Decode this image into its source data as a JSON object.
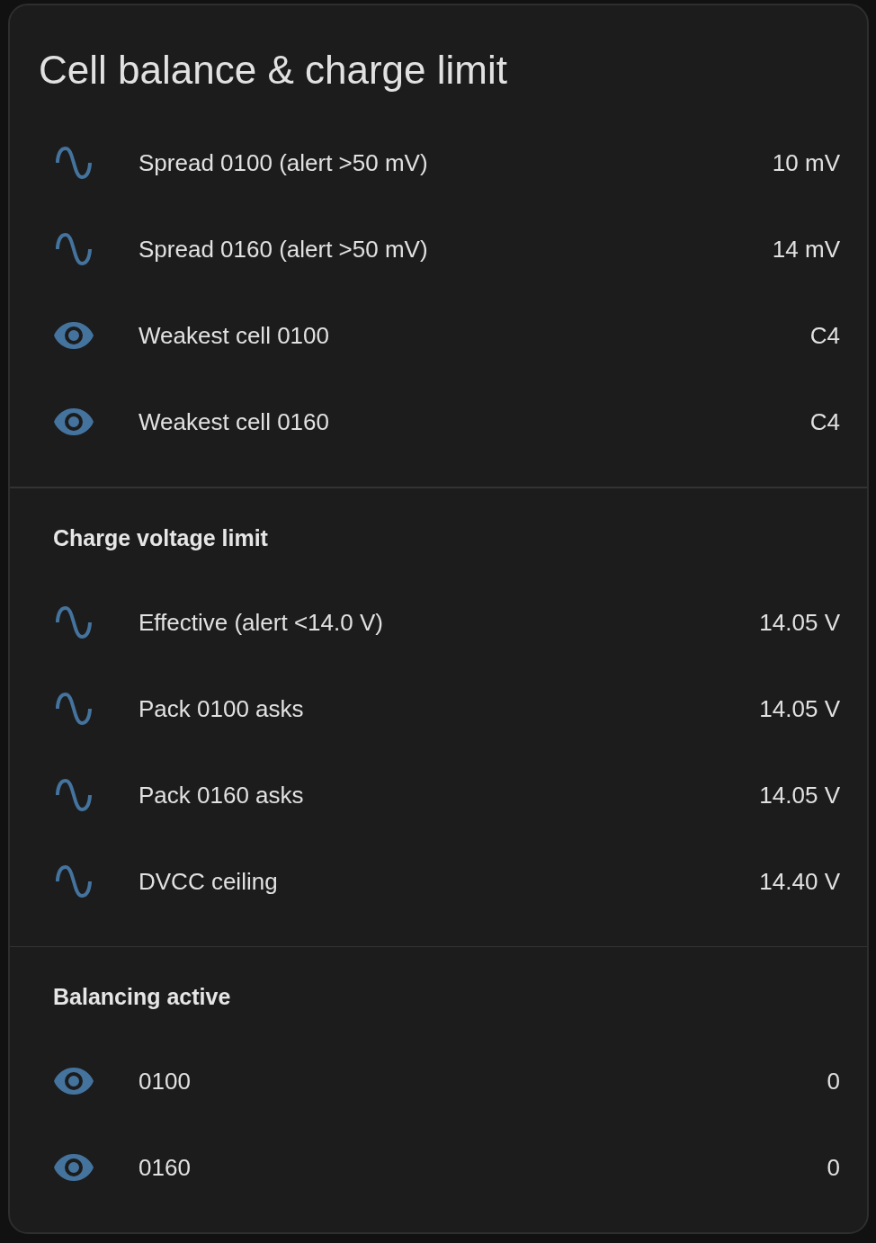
{
  "card": {
    "title": "Cell balance & charge limit",
    "sections": [
      {
        "rows": [
          {
            "kind": "measure",
            "name": "Spread 0100 (alert >50 mV)",
            "value": "10 mV"
          },
          {
            "kind": "measure",
            "name": "Spread 0160 (alert >50 mV)",
            "value": "14 mV"
          },
          {
            "kind": "watch",
            "name": "Weakest cell 0100",
            "value": "C4"
          },
          {
            "kind": "watch",
            "name": "Weakest cell 0160",
            "value": "C4"
          }
        ]
      },
      {
        "header": "Charge voltage limit",
        "rows": [
          {
            "kind": "measure",
            "name": "Effective (alert <14.0 V)",
            "value": "14.05 V"
          },
          {
            "kind": "measure",
            "name": "Pack 0100 asks",
            "value": "14.05 V"
          },
          {
            "kind": "measure",
            "name": "Pack 0160 asks",
            "value": "14.05 V"
          },
          {
            "kind": "measure",
            "name": "DVCC ceiling",
            "value": "14.40 V"
          }
        ]
      },
      {
        "header": "Balancing active",
        "rows": [
          {
            "kind": "watch",
            "name": "0100",
            "value": "0"
          },
          {
            "kind": "watch",
            "name": "0160",
            "value": "0"
          }
        ]
      }
    ]
  }
}
